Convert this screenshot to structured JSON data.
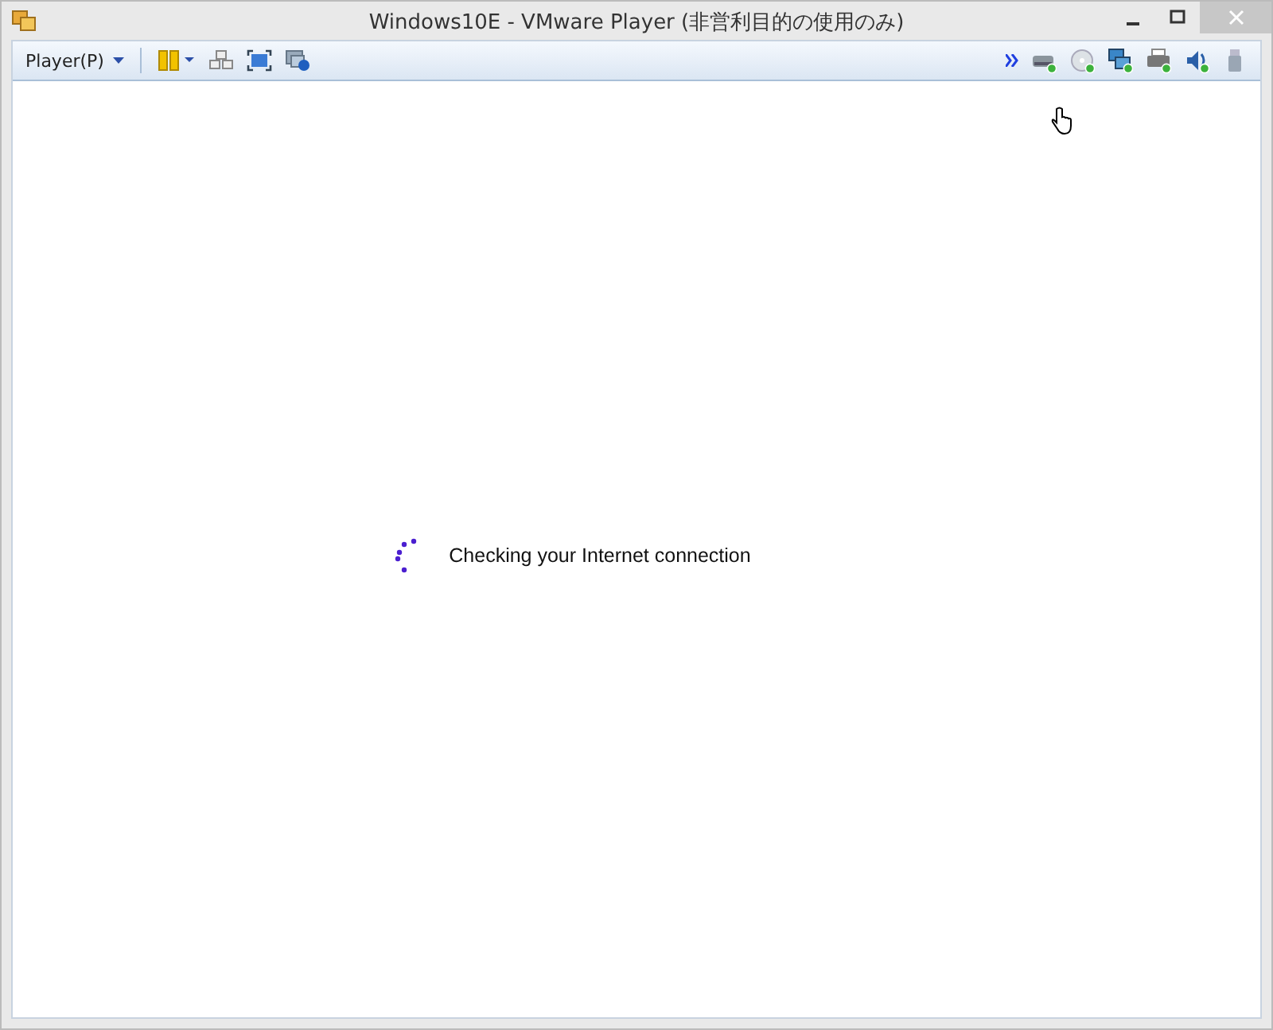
{
  "window": {
    "title": "Windows10E - VMware Player (非営利目的の使用のみ)"
  },
  "toolbar": {
    "player_menu": "Player(P)",
    "devices": [
      {
        "kind": "disk",
        "connected": true
      },
      {
        "kind": "cd",
        "connected": true
      },
      {
        "kind": "network",
        "connected": true
      },
      {
        "kind": "printer",
        "connected": true
      },
      {
        "kind": "sound",
        "connected": true
      },
      {
        "kind": "usb",
        "connected": false
      }
    ]
  },
  "guest": {
    "status": "Checking your Internet connection"
  }
}
